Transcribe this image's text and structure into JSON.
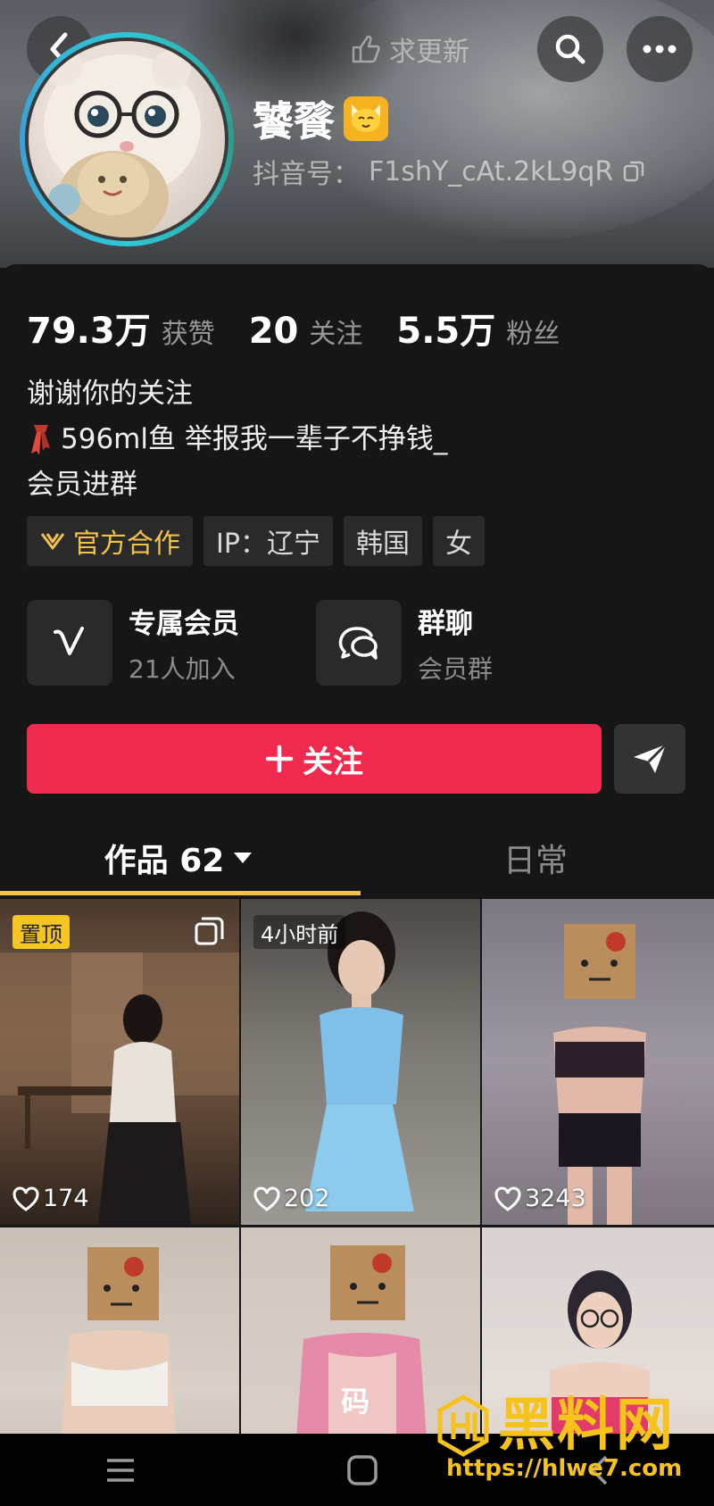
{
  "header": {
    "update_request": "求更新",
    "nickname": "饕餮",
    "douyin_id_label": "抖音号：",
    "douyin_id": "F1shY_cAt.2kL9qR"
  },
  "stats": [
    {
      "value": "79.3万",
      "label": "获赞"
    },
    {
      "value": "20",
      "label": "关注"
    },
    {
      "value": "5.5万",
      "label": "粉丝"
    }
  ],
  "bio": {
    "line1": "谢谢你的关注",
    "line2": "596ml鱼 举报我一辈子不挣钱_",
    "line3": "会员进群"
  },
  "tags": {
    "official": "官方合作",
    "ip": "IP：辽宁",
    "country": "韩国",
    "gender": "女"
  },
  "features": {
    "member": {
      "title": "专属会员",
      "subtitle": "21人加入"
    },
    "group": {
      "title": "群聊",
      "subtitle": "会员群"
    }
  },
  "actions": {
    "follow": "关注"
  },
  "tabs": {
    "works": "作品 62",
    "daily": "日常"
  },
  "grid": [
    {
      "badge": "置顶",
      "likes": "174"
    },
    {
      "badge": "4小时前",
      "likes": "202"
    },
    {
      "badge": "",
      "likes": "3243"
    },
    {
      "badge": "",
      "likes": ""
    },
    {
      "badge": "",
      "likes": "",
      "overlay": "码"
    },
    {
      "badge": "",
      "likes": ""
    }
  ],
  "watermark": {
    "title": "黑料网",
    "url": "https://hlwe7.com"
  },
  "colors": {
    "follow_button": "#f0294e",
    "tab_underline": "#f2c24a",
    "official_tag": "#f2c24a",
    "pin_badge": "#f5c623",
    "background": "#161616"
  },
  "icons": [
    "back-arrow-icon",
    "search-icon",
    "more-icon",
    "copy-icon",
    "vip-v-icon",
    "group-chat-icon",
    "plus-icon",
    "share-icon",
    "heart-icon",
    "caret-down-icon",
    "multi-image-icon"
  ]
}
